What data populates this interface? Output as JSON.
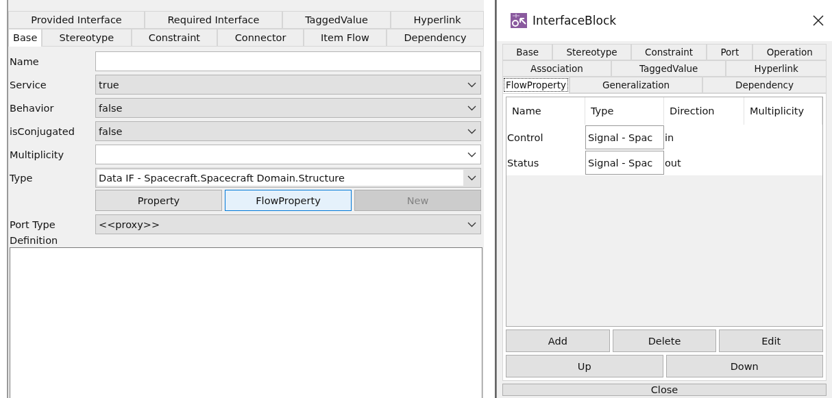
{
  "properties_panel": {
    "tab_rows": [
      [
        {
          "label": "Provided Interface",
          "selected": false
        },
        {
          "label": "Required Interface",
          "selected": false
        },
        {
          "label": "TaggedValue",
          "selected": false
        },
        {
          "label": "Hyperlink",
          "selected": false
        }
      ],
      [
        {
          "label": "Base",
          "selected": true
        },
        {
          "label": "Stereotype",
          "selected": false
        },
        {
          "label": "Constraint",
          "selected": false
        },
        {
          "label": "Connector",
          "selected": false
        },
        {
          "label": "Item Flow",
          "selected": false
        },
        {
          "label": "Dependency",
          "selected": false
        }
      ]
    ],
    "fields": [
      {
        "kind": "text",
        "label": "Name"
      },
      {
        "kind": "select",
        "label": "Service",
        "value": "true"
      },
      {
        "kind": "select",
        "label": "Behavior",
        "value": "false"
      },
      {
        "kind": "select",
        "label": "isConjugated",
        "value": "false"
      },
      {
        "kind": "combo",
        "label": "Multiplicity"
      },
      {
        "kind": "combo_inset",
        "label": "Type",
        "value": "Data IF - Spacecraft.Spacecraft Domain.Structure"
      },
      {
        "kind": "buttons",
        "buttons": [
          {
            "label": "Property",
            "focused": false,
            "disabled": false
          },
          {
            "label": "FlowProperty",
            "focused": true,
            "disabled": false
          },
          {
            "label": "New",
            "focused": false,
            "disabled": true
          }
        ]
      },
      {
        "kind": "select",
        "label": "Port Type",
        "value": "<<proxy>>"
      }
    ],
    "definition_label": "Definition"
  },
  "dialog": {
    "title": "InterfaceBlock",
    "tab_rows": [
      [
        {
          "label": "Base",
          "selected": false
        },
        {
          "label": "Stereotype",
          "selected": false
        },
        {
          "label": "Constraint",
          "selected": false
        },
        {
          "label": "Port",
          "selected": false
        },
        {
          "label": "Operation",
          "selected": false
        }
      ],
      [
        {
          "label": "Association",
          "selected": false
        },
        {
          "label": "TaggedValue",
          "selected": false
        },
        {
          "label": "Hyperlink",
          "selected": false
        }
      ],
      [
        {
          "label": "FlowProperty",
          "selected": true
        },
        {
          "label": "Generalization",
          "selected": false
        },
        {
          "label": "Dependency",
          "selected": false
        }
      ]
    ],
    "table": {
      "columns": [
        "Name",
        "Type",
        "Direction",
        "Multiplicity"
      ],
      "rows": [
        {
          "name": "Control",
          "type": "Signal - Spac",
          "direction": "in"
        },
        {
          "name": "Status",
          "type": "Signal - Spac",
          "direction": "out"
        }
      ]
    },
    "button_rows": [
      [
        "Add",
        "Delete",
        "Edit"
      ],
      [
        "Up",
        "Down"
      ]
    ],
    "close": "Close"
  }
}
